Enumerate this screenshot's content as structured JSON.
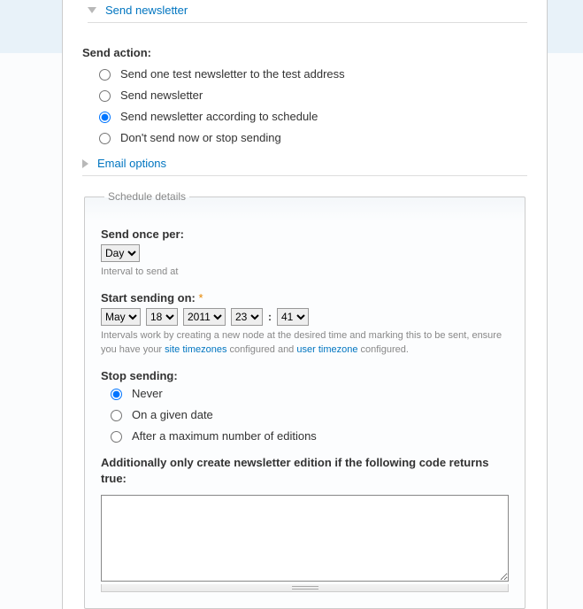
{
  "toggles": {
    "send_newsletter": "Send newsletter",
    "email_options": "Email options"
  },
  "send_action": {
    "label": "Send action:",
    "options": [
      "Send one test newsletter to the test address",
      "Send newsletter",
      "Send newsletter according to schedule",
      "Don't send now or stop sending"
    ],
    "selected_index": 2
  },
  "schedule": {
    "legend": "Schedule details",
    "send_once": {
      "label": "Send once per:",
      "value": "Day",
      "desc": "Interval to send at"
    },
    "start": {
      "label": "Start sending on:",
      "month": "May",
      "day": "18",
      "year": "2011",
      "hour": "23",
      "minute": "41",
      "desc_pre": "Intervals work by creating a new node at the desired time and marking this to be sent, ensure you have your ",
      "link1": "site timezones",
      "desc_mid": " configured and ",
      "link2": "user timezone",
      "desc_post": " configured."
    },
    "stop": {
      "label": "Stop sending:",
      "options": [
        "Never",
        "On a given date",
        "After a maximum number of editions"
      ],
      "selected_index": 0
    },
    "condition": {
      "label": "Additionally only create newsletter edition if the following code returns true:",
      "value": ""
    }
  }
}
